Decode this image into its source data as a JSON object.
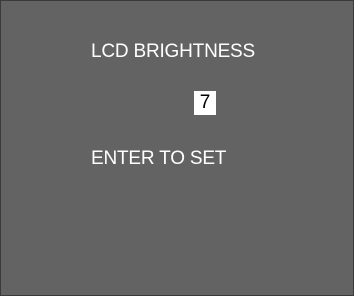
{
  "menu": {
    "title": "LCD BRIGHTNESS",
    "value": "7",
    "hint": "ENTER TO SET"
  },
  "colors": {
    "background": "#636363",
    "text": "#ffffff",
    "value_highlight": "#ffffff",
    "value_text": "#000000"
  }
}
